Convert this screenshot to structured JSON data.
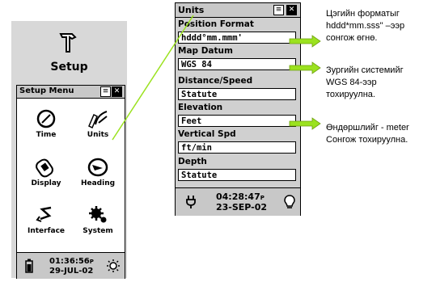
{
  "setup_label": "Setup",
  "setup_menu": {
    "title": "Setup Menu",
    "items": [
      {
        "label": "Time",
        "icon": "clock-icon"
      },
      {
        "label": "Units",
        "icon": "units-ruler-icon"
      },
      {
        "label": "Display",
        "icon": "display-icon"
      },
      {
        "label": "Heading",
        "icon": "compass-icon"
      },
      {
        "label": "Interface",
        "icon": "interface-icon"
      },
      {
        "label": "System",
        "icon": "system-gear-icon"
      }
    ],
    "status": {
      "time": "01:36:56",
      "time_suffix": "P",
      "date": "29-JUL-02"
    }
  },
  "units": {
    "title": "Units",
    "fields": [
      {
        "label": "Position Format",
        "value": "hddd°mm.mmm'"
      },
      {
        "label": "Map Datum",
        "value": "WGS 84"
      },
      {
        "label": "Distance/Speed",
        "value": "Statute"
      },
      {
        "label": "Elevation",
        "value": "Feet"
      },
      {
        "label": "Vertical Spd",
        "value": "ft/min"
      },
      {
        "label": "Depth",
        "value": "Statute"
      }
    ],
    "status": {
      "time": "04:28:47",
      "time_suffix": "P",
      "date": "23-SEP-02"
    }
  },
  "notes": [
    {
      "lines": [
        "Цэгийн форматыг",
        "hddd*mm.sss\" –ээр",
        "сонгож өгнө."
      ]
    },
    {
      "lines": [
        "Зургийн системийг",
        "WGS 84-ээр",
        "тохируулна."
      ]
    },
    {
      "lines": [
        "Өндөршлийг - meter",
        "Сонгож тохируулна."
      ]
    }
  ],
  "colors": {
    "arrow": "#9be21f",
    "bg": "#ffffff",
    "panel": "#d8d8d8"
  }
}
